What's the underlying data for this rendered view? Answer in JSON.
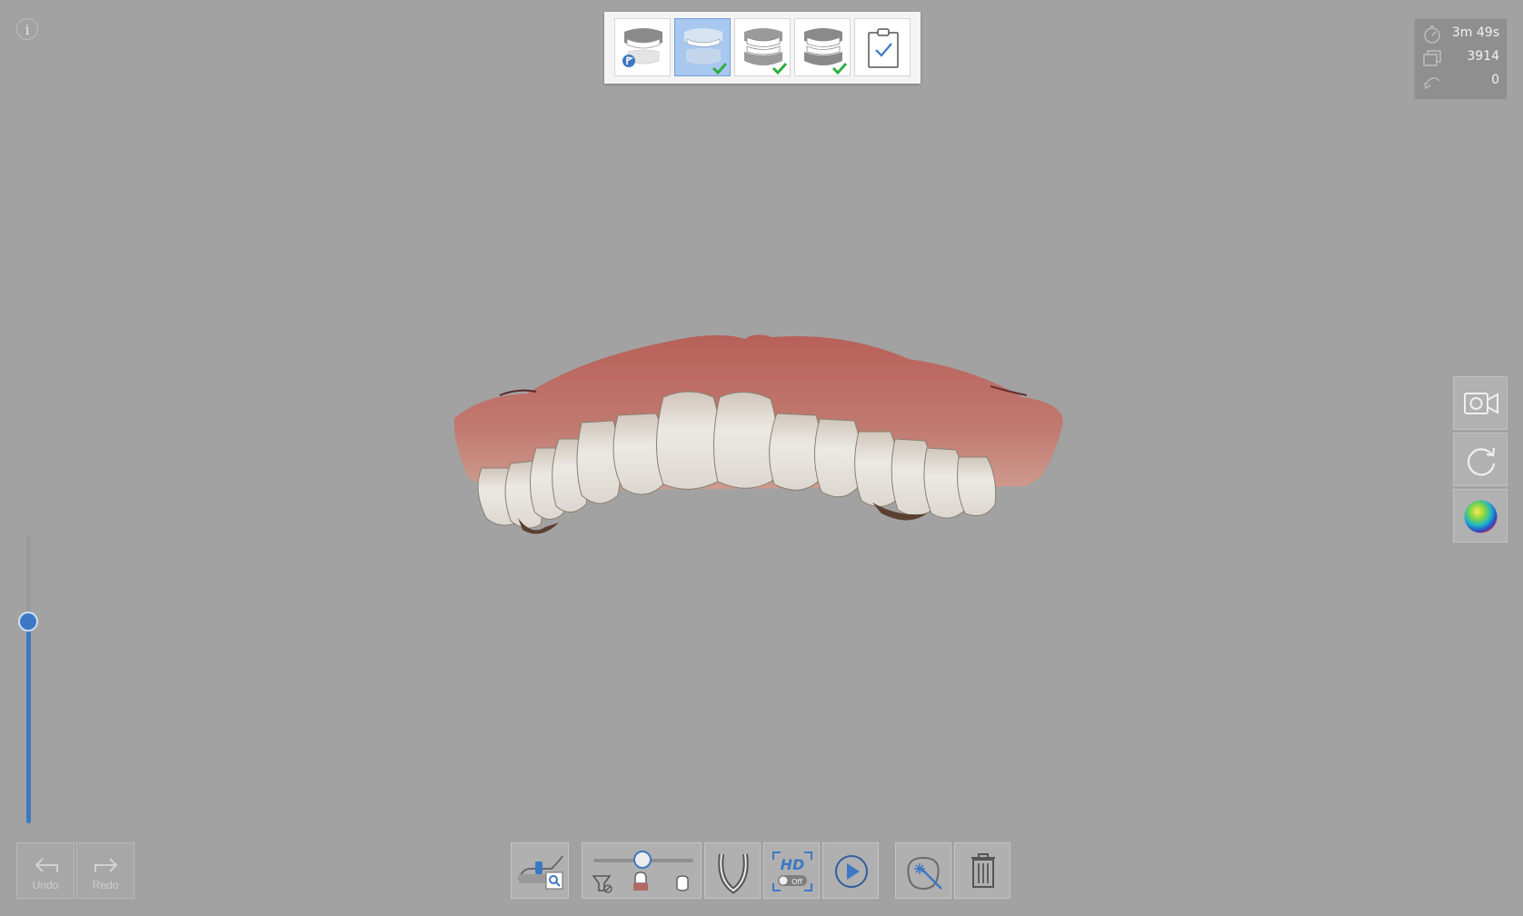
{
  "info_button": {
    "label": "i",
    "icon": "info-icon"
  },
  "stages": [
    {
      "name": "upper-jaw-stage",
      "icon": "upper-jaw-icon",
      "state": "current-flag"
    },
    {
      "name": "lower-jaw-stage",
      "icon": "lower-jaw-icon",
      "state": "selected-complete"
    },
    {
      "name": "occlusion-stage-1",
      "icon": "occlusion-icon",
      "state": "complete"
    },
    {
      "name": "occlusion-stage-2",
      "icon": "occlusion-icon",
      "state": "complete"
    },
    {
      "name": "review-stage",
      "icon": "clipboard-check-icon",
      "state": "pending"
    }
  ],
  "stats": {
    "time": "3m 49s",
    "frames": "3914",
    "rotations": "0"
  },
  "side_tools": [
    {
      "name": "video-record-button",
      "icon": "video-camera-icon"
    },
    {
      "name": "reset-view-button",
      "icon": "rotate-icon"
    },
    {
      "name": "color-mode-button",
      "icon": "color-sphere-icon"
    }
  ],
  "undo": {
    "label": "Undo"
  },
  "redo": {
    "label": "Redo"
  },
  "filter_slider_value": 0.5,
  "depth_slider_value": 0.7,
  "hd_toggle": {
    "label": "HD",
    "state": "Off"
  },
  "colors": {
    "background": "#a2a2a2",
    "accent": "#3d78c5",
    "check": "#2fae3e"
  }
}
